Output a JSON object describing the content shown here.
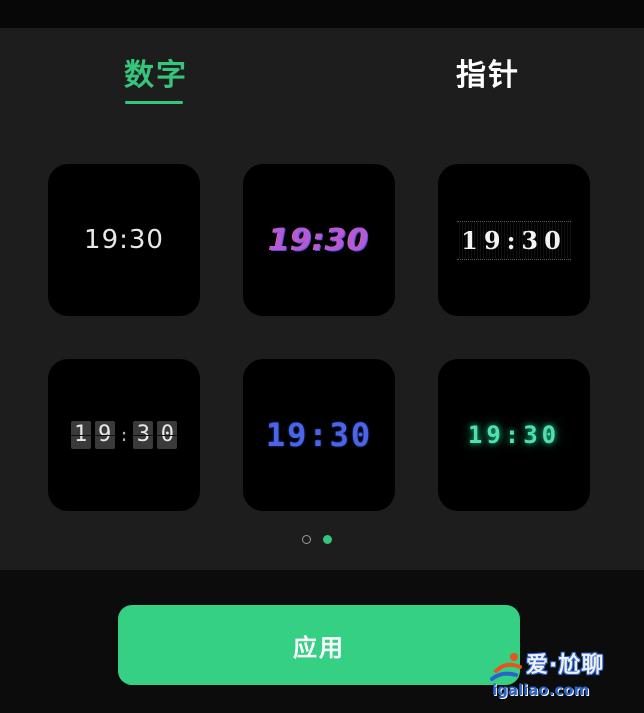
{
  "tabs": [
    {
      "label": "数字",
      "active": true
    },
    {
      "label": "指针",
      "active": false
    }
  ],
  "faces": [
    {
      "time": "19:30",
      "style": "plain-thin"
    },
    {
      "time": "19:30",
      "style": "gradient-purple"
    },
    {
      "time": "19:30",
      "style": "serif-banded"
    },
    {
      "time_digits": [
        "1",
        "9",
        "3",
        "0"
      ],
      "separator": ":",
      "style": "flip-cards"
    },
    {
      "time": "19:30",
      "style": "blue-dot-matrix"
    },
    {
      "time": "19:30",
      "style": "green-glow"
    }
  ],
  "pager": {
    "count": 2,
    "active_index": 1
  },
  "apply": {
    "label": "应用"
  },
  "watermark": {
    "title": "爱·尬聊",
    "url": "igaliao.com"
  },
  "colors": {
    "accent": "#35c67b",
    "button": "#35d084",
    "panel": "#1d1d1d",
    "tile": "#000000"
  }
}
